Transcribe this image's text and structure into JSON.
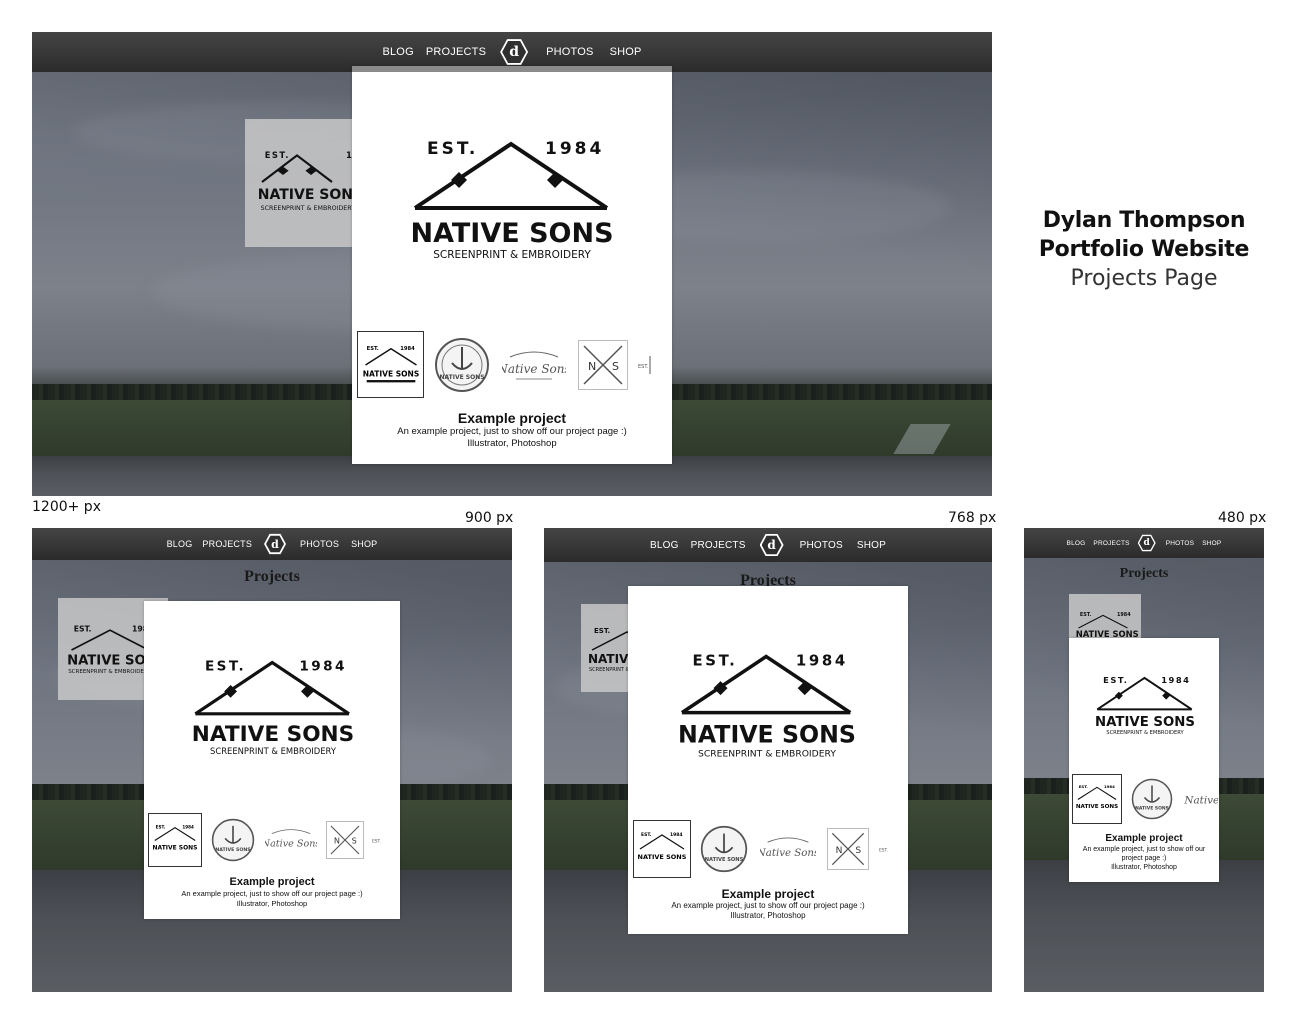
{
  "caption": {
    "line1": "Dylan Thompson",
    "line2": "Portfolio Website",
    "line3": "Projects Page"
  },
  "nav": {
    "links_left": [
      "BLOG",
      "PROJECTS"
    ],
    "links_right": [
      "PHOTOS",
      "SHOP"
    ],
    "logo_glyph": "d"
  },
  "page_heading": "Projects",
  "logo": {
    "est": "EST.",
    "year": "1984",
    "name": "NATIVE SONS",
    "tagline": "SCREENPRINT & EMBROIDERY"
  },
  "thumbnails": {
    "badge_est": "EST.",
    "badge_year": "1984",
    "badge_name": "NATIVE SONS",
    "script_name": "Native Sons",
    "cross_n": "N",
    "cross_s": "S",
    "partial_est": "EST."
  },
  "project": {
    "title": "Example project",
    "description": "An example project, just to show off our project page :)",
    "tools": "Illustrator, Photoshop"
  },
  "breakpoints": {
    "large": "1200+ px",
    "medium": "900 px",
    "small": "768 px",
    "xsmall": "480 px"
  },
  "colors": {
    "navbar": "#2f2f2f",
    "modal": "#ffffff",
    "text": "#111111"
  }
}
